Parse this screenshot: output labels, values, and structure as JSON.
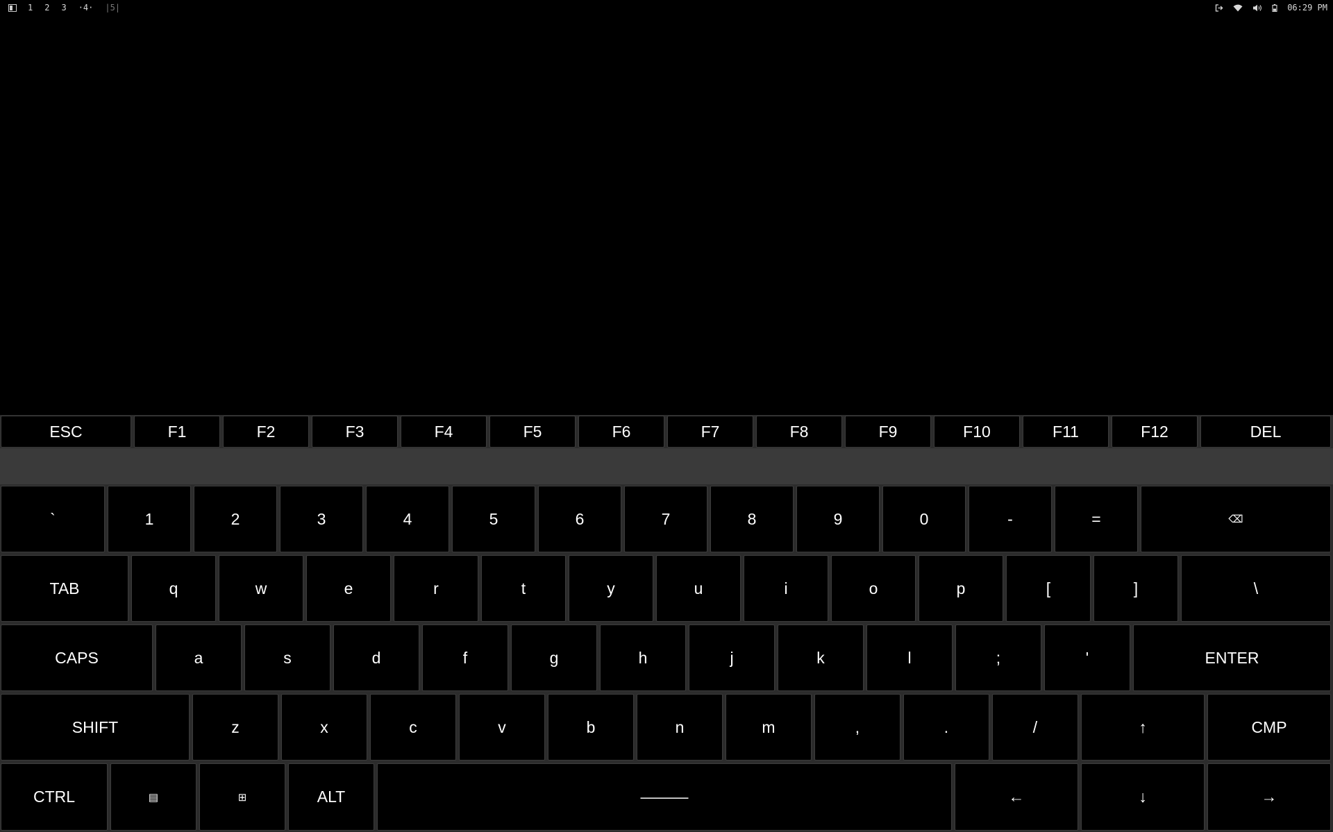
{
  "topbar": {
    "workspaces": [
      "1",
      "2",
      "3",
      "·4·",
      "|5|"
    ],
    "clock": "06:29 PM",
    "tray_icons": [
      "logout-icon",
      "wifi-icon",
      "volume-icon",
      "battery-icon"
    ]
  },
  "keyboard": {
    "fn_row": [
      "ESC",
      "F1",
      "F2",
      "F3",
      "F4",
      "F5",
      "F6",
      "F7",
      "F8",
      "F9",
      "F10",
      "F11",
      "F12",
      "DEL"
    ],
    "row1": [
      "`",
      "1",
      "2",
      "3",
      "4",
      "5",
      "6",
      "7",
      "8",
      "9",
      "0",
      "-",
      "=",
      "⌫"
    ],
    "row2": [
      "TAB",
      "q",
      "w",
      "e",
      "r",
      "t",
      "y",
      "u",
      "i",
      "o",
      "p",
      "[",
      "]",
      "\\"
    ],
    "row3": [
      "CAPS",
      "a",
      "s",
      "d",
      "f",
      "g",
      "h",
      "j",
      "k",
      "l",
      ";",
      "'",
      "ENTER"
    ],
    "row4": [
      "SHIFT",
      "z",
      "x",
      "c",
      "v",
      "b",
      "n",
      "m",
      ",",
      ".",
      "/",
      "↑",
      "CMP"
    ],
    "row5": [
      "CTRL",
      "▤",
      "⊞",
      "ALT",
      "———",
      "←",
      "↓",
      "→"
    ]
  }
}
